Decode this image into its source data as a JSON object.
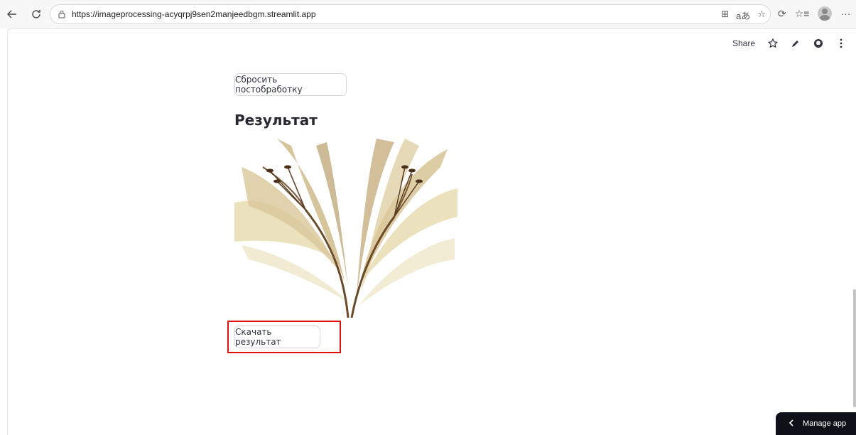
{
  "browser": {
    "url": "https://imageprocessing-acyqrpj9sen2manjeedbgm.streamlit.app",
    "back_icon": "arrow-left-icon",
    "refresh_icon": "refresh-icon"
  },
  "header": {
    "share_label": "Share"
  },
  "main": {
    "reset_button_label": "Сбросить постобработку",
    "result_title": "Результат",
    "download_button_label": "Скачать результат"
  },
  "manage_app": {
    "label": "Manage app"
  },
  "colors": {
    "highlight": "#e01010",
    "manage_bg": "#0e1117"
  }
}
